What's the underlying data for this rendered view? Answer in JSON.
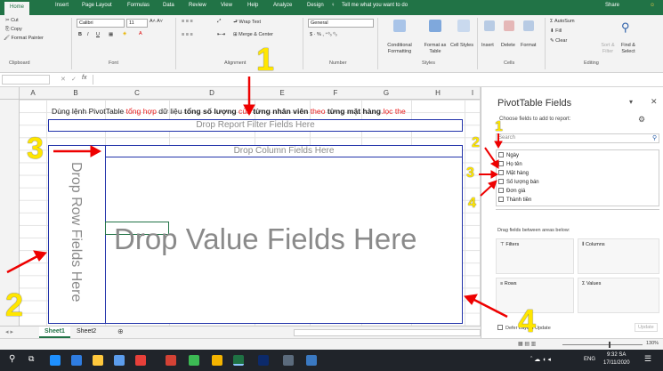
{
  "ribbon_tabs": [
    "Home",
    "Insert",
    "Page Layout",
    "Formulas",
    "Data",
    "Review",
    "View",
    "Help",
    "Analyze",
    "Design",
    "Tell me what you want to do"
  ],
  "share": "Share",
  "clipboard": {
    "cut": "Cut",
    "copy": "Copy",
    "format_painter": "Format Painter",
    "label": "Clipboard"
  },
  "font": {
    "name": "Calibri",
    "size": "11",
    "label": "Font"
  },
  "alignment": {
    "wrap": "Wrap Text",
    "merge": "Merge & Center",
    "label": "Alignment"
  },
  "number": {
    "format": "General",
    "label": "Number"
  },
  "styles": {
    "conditional": "Conditional Formatting",
    "format_table": "Format as Table",
    "cell_styles": "Cell Styles",
    "label": "Styles"
  },
  "cells": {
    "insert": "Insert",
    "delete": "Delete",
    "format": "Format",
    "label": "Cells"
  },
  "editing": {
    "autosum": "AutoSum",
    "fill": "Fill",
    "clear": "Clear",
    "sort": "Sort & Filter",
    "find": "Find & Select",
    "label": "Editing"
  },
  "formula_bar": {
    "fx": "fx",
    "x": "✕",
    "check": "✓"
  },
  "columns": [
    "A",
    "B",
    "C",
    "D",
    "E",
    "F",
    "G",
    "H",
    "I"
  ],
  "title_row": {
    "p1": "Dùng lệnh PivotTable ",
    "p2": "tổng hợp",
    "p3": " dữ liệu ",
    "p4": "tổng số lượng",
    "p5": " của ",
    "p6": "từng nhân viên",
    "p7": " theo ",
    "p8": "từng mặt hàng",
    "p9": ".lọc the"
  },
  "pivot": {
    "report_filter": "Drop Report Filter Fields Here",
    "column_fields": "Drop Column Fields Here",
    "row_fields": "Drop Row Fields Here",
    "value_fields": "Drop Value Fields Here"
  },
  "sheets": [
    "Sheet1",
    "Sheet2"
  ],
  "pane": {
    "title": "PivotTable Fields",
    "choose": "Choose fields to add to report:",
    "search": "Search",
    "fields": [
      "Ngày",
      "Họ tên",
      "Mặt hàng",
      "Số lượng bán",
      "Đơn giá",
      "Thành tiền"
    ],
    "drag": "Drag fields between areas below:",
    "filters": "Filters",
    "columns": "Columns",
    "rows": "Rows",
    "values": "Values",
    "defer": "Defer Layout Update",
    "update": "Update"
  },
  "annotations": {
    "n1": "1",
    "n2": "2",
    "n3": "3",
    "n4": "4",
    "s1": "1",
    "s2": "2",
    "s3": "3",
    "s4": "4"
  },
  "status": {
    "zoom": "130%"
  },
  "taskbar": {
    "lang": "ENG",
    "time": "9:32 SA",
    "date": "17/11/2020"
  }
}
